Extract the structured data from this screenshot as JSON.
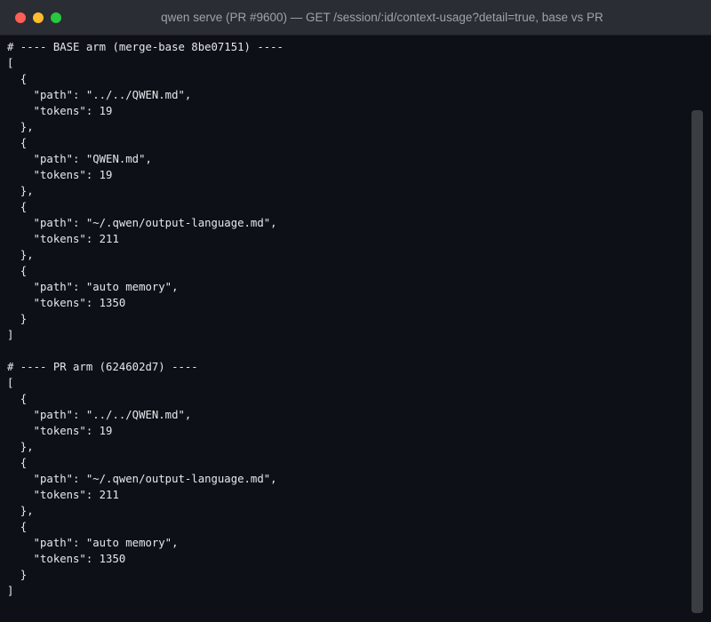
{
  "window": {
    "title": "qwen serve (PR #9600) — GET /session/:id/context-usage?detail=true, base vs PR"
  },
  "terminal": {
    "lines": [
      "# ---- BASE arm (merge-base 8be07151) ----",
      "[",
      "  {",
      "    \"path\": \"../../QWEN.md\",",
      "    \"tokens\": 19",
      "  },",
      "  {",
      "    \"path\": \"QWEN.md\",",
      "    \"tokens\": 19",
      "  },",
      "  {",
      "    \"path\": \"~/.qwen/output-language.md\",",
      "    \"tokens\": 211",
      "  },",
      "  {",
      "    \"path\": \"auto memory\",",
      "    \"tokens\": 1350",
      "  }",
      "]",
      "",
      "# ---- PR arm (624602d7) ----",
      "[",
      "  {",
      "    \"path\": \"../../QWEN.md\",",
      "    \"tokens\": 19",
      "  },",
      "  {",
      "    \"path\": \"~/.qwen/output-language.md\",",
      "    \"tokens\": 211",
      "  },",
      "  {",
      "    \"path\": \"auto memory\",",
      "    \"tokens\": 1350",
      "  }",
      "]"
    ]
  },
  "colors": {
    "close": "#fe5f57",
    "minimize": "#febc2e",
    "zoom": "#28c840",
    "background": "#0d1117",
    "text": "#e6e8eb"
  }
}
